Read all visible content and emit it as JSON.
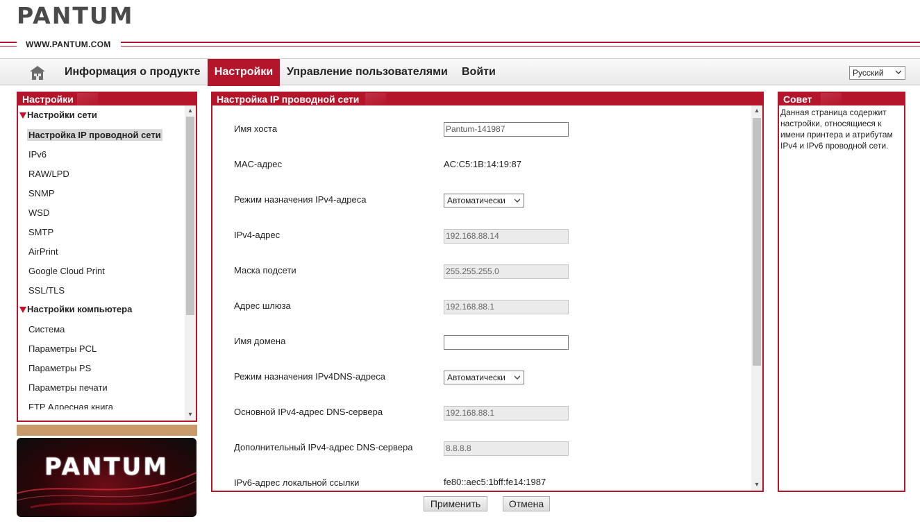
{
  "header": {
    "logo": "PANTUM",
    "site_url": "WWW.PANTUM.COM"
  },
  "nav": {
    "home_icon": "home-icon",
    "items": [
      "Информация о продукте",
      "Настройки",
      "Управление пользователями",
      "Войти"
    ],
    "active": "Настройки",
    "language": "Русский"
  },
  "sidebar": {
    "title": "Настройки",
    "groups": [
      {
        "label": "Настройки сети",
        "items": [
          "Настройка IP проводной сети",
          "IPv6",
          "RAW/LPD",
          "SNMP",
          "WSD",
          "SMTP",
          "AirPrint",
          "Google Cloud Print",
          "SSL/TLS"
        ]
      },
      {
        "label": "Настройки компьютера",
        "items": [
          "Система",
          "Параметры PCL",
          "Параметры PS",
          "Параметры печати",
          "FTP Адресная книга"
        ]
      }
    ],
    "selected": "Настройка IP проводной сети",
    "brand_logo": "PANTUM"
  },
  "main": {
    "title": "Настройка IP проводной сети",
    "fields": {
      "hostname": {
        "label": "Имя хоста",
        "value": "Pantum-141987"
      },
      "mac": {
        "label": "MAC-адрес",
        "value": "AC:C5:1B:14:19:87"
      },
      "ipv4_mode": {
        "label": "Режим назначения IPv4-адреса",
        "value": "Автоматически"
      },
      "ipv4_address": {
        "label": "IPv4-адрес",
        "value": "192.168.88.14"
      },
      "subnet_mask": {
        "label": "Маска подсети",
        "value": "255.255.255.0"
      },
      "gateway": {
        "label": "Адрес шлюза",
        "value": "192.168.88.1"
      },
      "domain": {
        "label": "Имя домена",
        "value": ""
      },
      "dns_mode": {
        "label": "Режим назначения IPv4DNS-адреса",
        "value": "Автоматически"
      },
      "dns_primary": {
        "label": "Основной IPv4-адрес DNS-сервера",
        "value": "192.168.88.1"
      },
      "dns_secondary": {
        "label": "Дополнительный IPv4-адрес DNS-сервера",
        "value": "8.8.8.8"
      },
      "ipv6_link_local": {
        "label": "IPv6-адрес локальной ссылки",
        "value": "fe80::aec5:1bff:fe14:1987"
      }
    },
    "apply_label": "Применить",
    "cancel_label": "Отмена"
  },
  "tip": {
    "title": "Совет",
    "text": "Данная страница содержит настройки, относящиеся к имени принтера и атрибутам IPv4 и IPv6 проводной сети."
  },
  "colors": {
    "accent": "#b5152b",
    "tan": "#c99a6a"
  }
}
